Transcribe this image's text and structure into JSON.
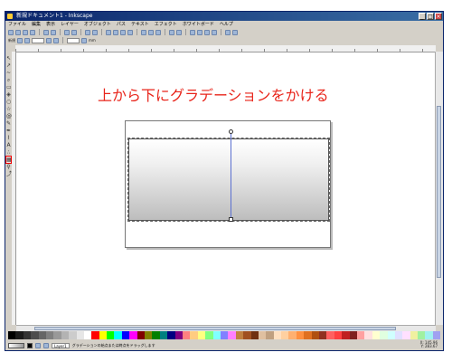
{
  "window": {
    "title": "新規ドキュメント1 - Inkscape",
    "buttons": {
      "minimize": "_",
      "maximize": "□",
      "close": "×"
    }
  },
  "menu": [
    "ファイル",
    "編集",
    "表示",
    "レイヤー",
    "オブジェクト",
    "パス",
    "テキスト",
    "エフェクト",
    "ホワイトボード",
    "ヘルプ"
  ],
  "toolbar2": {
    "new_label": "新規",
    "x_field": "",
    "unit": "mm"
  },
  "tools": [
    "pointer",
    "node",
    "zoom",
    "rect",
    "3dbox",
    "ellipse",
    "star",
    "spiral",
    "pencil",
    "pen",
    "calligraphy",
    "text",
    "spray",
    "gradient",
    "dropper",
    "connector"
  ],
  "selected_tool": "gradient",
  "annotation": "上から下にグラデーションをかける",
  "statusbar": {
    "layer": "Layer1",
    "message": "グラデーションの始点または終点をドラッグします",
    "coords_x": "X: 145.96",
    "coords_y": "Y: 283.67",
    "zoom": "35%"
  },
  "palette": [
    "#000000",
    "#1a1a1a",
    "#333333",
    "#4d4d4d",
    "#666666",
    "#808080",
    "#999999",
    "#b3b3b3",
    "#cccccc",
    "#e6e6e6",
    "#ffffff",
    "#ff0000",
    "#ffff00",
    "#00ff00",
    "#00ffff",
    "#0000ff",
    "#ff00ff",
    "#800000",
    "#808000",
    "#008000",
    "#008080",
    "#000080",
    "#800080",
    "#ff8080",
    "#ffcc80",
    "#ffff80",
    "#80ff80",
    "#80ffff",
    "#8080ff",
    "#ff80ff",
    "#c08040",
    "#a05020",
    "#703010",
    "#e0c0a0",
    "#c0a080",
    "#ffe0c0",
    "#ffd0a0",
    "#ffb070",
    "#ff9040",
    "#e07020",
    "#b05010",
    "#903020",
    "#ff6060",
    "#ff4040",
    "#c02020",
    "#802020",
    "#ffa0a0",
    "#ffe0e0",
    "#ffffd0",
    "#e0ffe0",
    "#d0ffff",
    "#e0e0ff",
    "#ffe0ff",
    "#f0f0a0",
    "#a0f0a0",
    "#a0f0f0",
    "#a0a0f0"
  ]
}
